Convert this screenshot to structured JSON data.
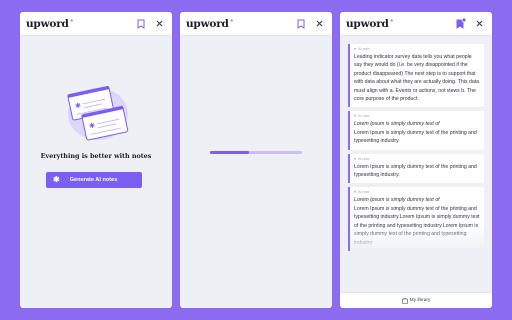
{
  "brand": {
    "name": "upword",
    "mark": "+"
  },
  "icons": {
    "bookmark": "bookmark-icon",
    "close": "close-icon",
    "notification_dot": "notification-dot-icon",
    "note_tag": "heart-icon",
    "sparkle": "sparkle-icon",
    "library": "library-icon"
  },
  "colors": {
    "accent": "#7b5ff0",
    "background": "#8b6cf0",
    "panel": "#eef0f5"
  },
  "panel_empty": {
    "title": "Everything is better with notes",
    "generate_button": "Generate AI notes"
  },
  "panel_loading": {
    "progress": 0.42
  },
  "panel_notes": {
    "tag_label": "AI note",
    "notes": [
      {
        "text": "Leading indicator survey data tells you what people say they would do (i.e. be very disappointed if the product disappeared) The next step is to support that with data about what they are actually doing. This data must align with a. Events or actions, not views b. The core purpose of the product."
      },
      {
        "lead": "Lorem Ipsum is simply dummy text of",
        "text": "Lorem Ipsum is simply dummy text of the printing and typesetting industry."
      },
      {
        "text": "Lorem Ipsum is simply dummy text of the printing and typesetting industry."
      },
      {
        "lead": "Lorem Ipsum is simply dummy text of",
        "text": "Lorem Ipsum is simply dummy text of the printing and typesetting industry.Lorem Ipsum is simply dummy text of the printing and typesetting industry.Lorem Ipsum is simply dummy text of the printing and typesetting industry."
      }
    ],
    "footer_label": "My library"
  }
}
